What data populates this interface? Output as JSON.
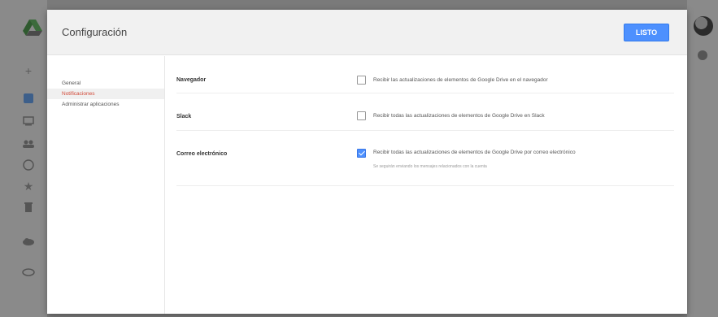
{
  "background_app": {
    "icons": [
      "drive-logo",
      "new-plus-icon",
      "my-drive-icon",
      "computers-icon",
      "shared-icon",
      "recent-icon",
      "starred-icon",
      "trash-icon",
      "backups-icon",
      "storage-icon"
    ],
    "right_icons": [
      "avatar",
      "settings-icon"
    ]
  },
  "dialog": {
    "title": "Configuración",
    "done_label": "LISTO",
    "nav": [
      {
        "label": "General",
        "active": false
      },
      {
        "label": "Notificaciones",
        "active": true
      },
      {
        "label": "Administrar aplicaciones",
        "active": false
      }
    ],
    "sections": [
      {
        "label": "Navegador",
        "checked": false,
        "text": "Recibir las actualizaciones de elementos de Google Drive en el navegador"
      },
      {
        "label": "Slack",
        "checked": false,
        "text": "Recibir todas las actualizaciones de elementos de Google Drive en Slack"
      },
      {
        "label": "Correo electrónico",
        "checked": true,
        "text": "Recibir todas las actualizaciones de elementos de Google Drive por correo electrónico",
        "subtext": "Se seguirán enviando los mensajes relacionados con la cuenta"
      }
    ]
  },
  "colors": {
    "accent": "#4d90fe",
    "active_nav": "#d14836"
  }
}
